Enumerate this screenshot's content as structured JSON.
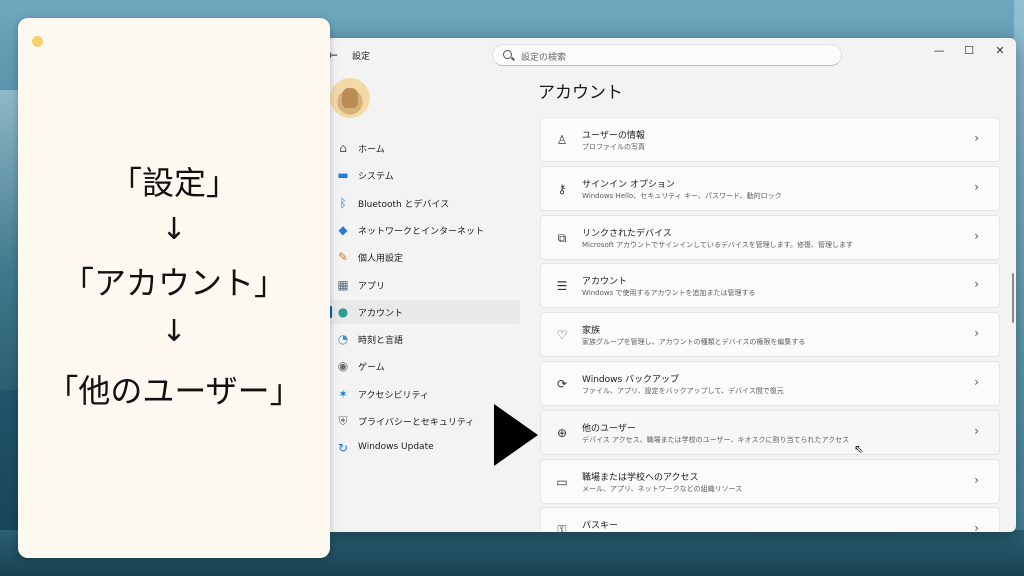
{
  "window": {
    "title": "設定",
    "back": "←",
    "search_placeholder": "設定の検索",
    "minimize": "—",
    "maximize": "☐",
    "close": "✕"
  },
  "sidebar": {
    "items": [
      {
        "label": "ホーム",
        "icon": "home-icon",
        "glyph": "⌂"
      },
      {
        "label": "システム",
        "icon": "monitor-icon",
        "glyph": "▬"
      },
      {
        "label": "Bluetooth とデバイス",
        "icon": "bluetooth-icon",
        "glyph": "ᛒ"
      },
      {
        "label": "ネットワークとインターネット",
        "icon": "wifi-icon",
        "glyph": "◆"
      },
      {
        "label": "個人用設定",
        "icon": "brush-icon",
        "glyph": "✎"
      },
      {
        "label": "アプリ",
        "icon": "apps-icon",
        "glyph": "▦"
      },
      {
        "label": "アカウント",
        "icon": "account-icon",
        "glyph": "●",
        "active": true
      },
      {
        "label": "時刻と言語",
        "icon": "globe-icon",
        "glyph": "◔"
      },
      {
        "label": "ゲーム",
        "icon": "gamepad-icon",
        "glyph": "◉"
      },
      {
        "label": "アクセシビリティ",
        "icon": "accessibility-icon",
        "glyph": "✶"
      },
      {
        "label": "プライバシーとセキュリティ",
        "icon": "shield-icon",
        "glyph": "⛨"
      },
      {
        "label": "Windows Update",
        "icon": "update-icon",
        "glyph": "↻"
      }
    ]
  },
  "main": {
    "title": "アカウント",
    "cards": [
      {
        "title": "ユーザーの情報",
        "desc": "プロファイルの写真",
        "icon": "person-icon",
        "glyph": "♙"
      },
      {
        "title": "サインイン オプション",
        "desc": "Windows Hello、セキュリティ キー、パスワード、動的ロック",
        "icon": "key-icon",
        "glyph": "⚷"
      },
      {
        "title": "リンクされたデバイス",
        "desc": "Microsoft アカウントでサインインしているデバイスを管理します。修復、管理します",
        "icon": "linked-devices-icon",
        "glyph": "⧉"
      },
      {
        "title": "アカウント",
        "desc": "Windows で使用するアカウントを追加または管理する",
        "icon": "accounts-list-icon",
        "glyph": "☰"
      },
      {
        "title": "家族",
        "desc": "家族グループを管理し、アカウントの種類とデバイスの権限を編集する",
        "icon": "family-heart-icon",
        "glyph": "♡"
      },
      {
        "title": "Windows バックアップ",
        "desc": "ファイル、アプリ、設定をバックアップして、デバイス間で復元",
        "icon": "backup-icon",
        "glyph": "⟳"
      },
      {
        "title": "他のユーザー",
        "desc": "デバイス アクセス、職場または学校のユーザー、キオスクに割り当てられたアクセス",
        "icon": "add-user-icon",
        "glyph": "⊕",
        "hover": true
      },
      {
        "title": "職場または学校へのアクセス",
        "desc": "メール、アプリ、ネットワークなどの組織リソース",
        "icon": "briefcase-icon",
        "glyph": "▭"
      },
      {
        "title": "パスキー",
        "desc": "",
        "icon": "passkey-icon",
        "glyph": "⚿"
      }
    ],
    "chevron": "›"
  },
  "annotation": {
    "step1": "「設定」",
    "arrow1": "↓",
    "step2": "「アカウント」",
    "arrow2": "↓",
    "step3": "「他のユーザー」"
  }
}
